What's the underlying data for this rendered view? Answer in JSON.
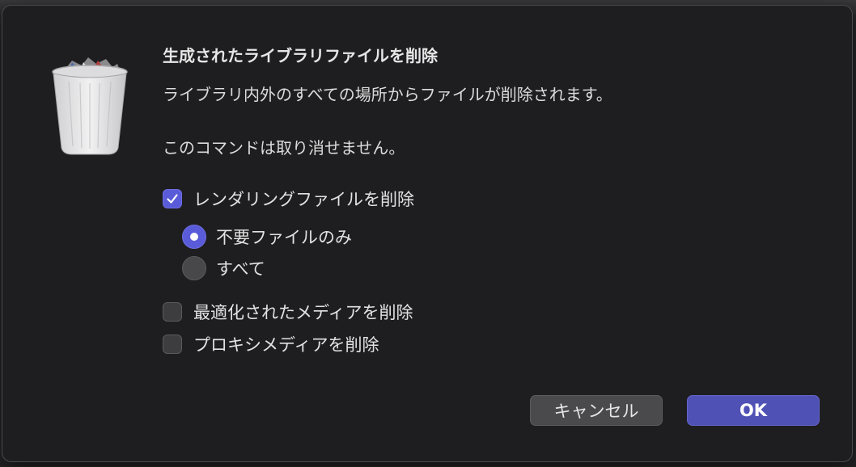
{
  "dialog": {
    "title": "生成されたライブラリファイルを削除",
    "message": "ライブラリ内外のすべての場所からファイルが削除されます。",
    "warning": "このコマンドは取り消せません。",
    "icon": "trash-icon"
  },
  "options": {
    "delete_render_files": {
      "label": "レンダリングファイルを削除",
      "checked": true
    },
    "render_scope": {
      "unused_only": {
        "label": "不要ファイルのみ",
        "selected": true
      },
      "all": {
        "label": "すべて",
        "selected": false
      }
    },
    "delete_optimized_media": {
      "label": "最適化されたメディアを削除",
      "checked": false
    },
    "delete_proxy_media": {
      "label": "プロキシメディアを削除",
      "checked": false
    }
  },
  "buttons": {
    "cancel": "キャンセル",
    "ok": "OK"
  },
  "colors": {
    "accent": "#5a5bd8",
    "dialog_background": "#1e1e20",
    "ok_button": "#5051b5"
  }
}
